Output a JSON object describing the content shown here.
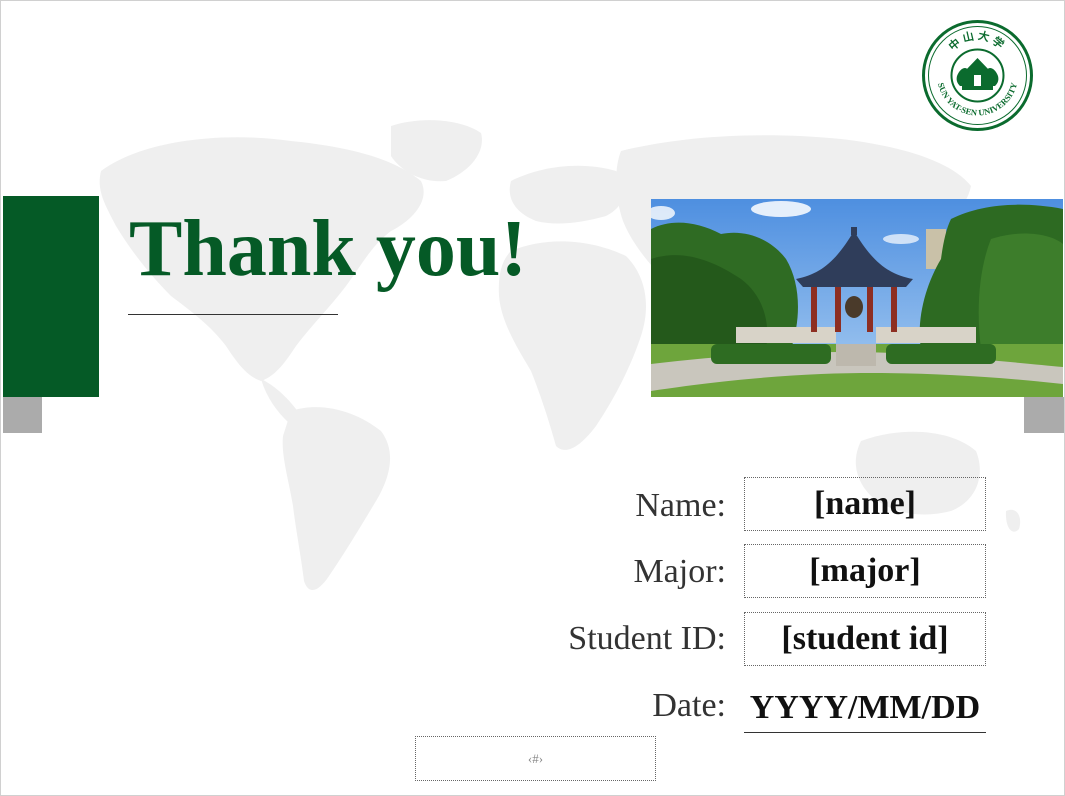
{
  "slide": {
    "title": "Thank you!",
    "fields": [
      {
        "label": "Name:",
        "value": "[name]"
      },
      {
        "label": "Major:",
        "value": "[major]"
      },
      {
        "label": "Student ID:",
        "value": "[student id]"
      },
      {
        "label": "Date:",
        "value": "YYYY/MM/DD"
      }
    ],
    "slide_number_placeholder": "‹#›"
  },
  "logo": {
    "icon": "university-seal-icon",
    "chinese_name": "中山大学",
    "english_name": "SUN YAT-SEN UNIVERSITY"
  },
  "photo": {
    "icon": "campus-pavilion-photo"
  },
  "colors": {
    "brand_green": "#055a26",
    "tab_gray": "#ababab",
    "map_gray": "#efefef"
  }
}
